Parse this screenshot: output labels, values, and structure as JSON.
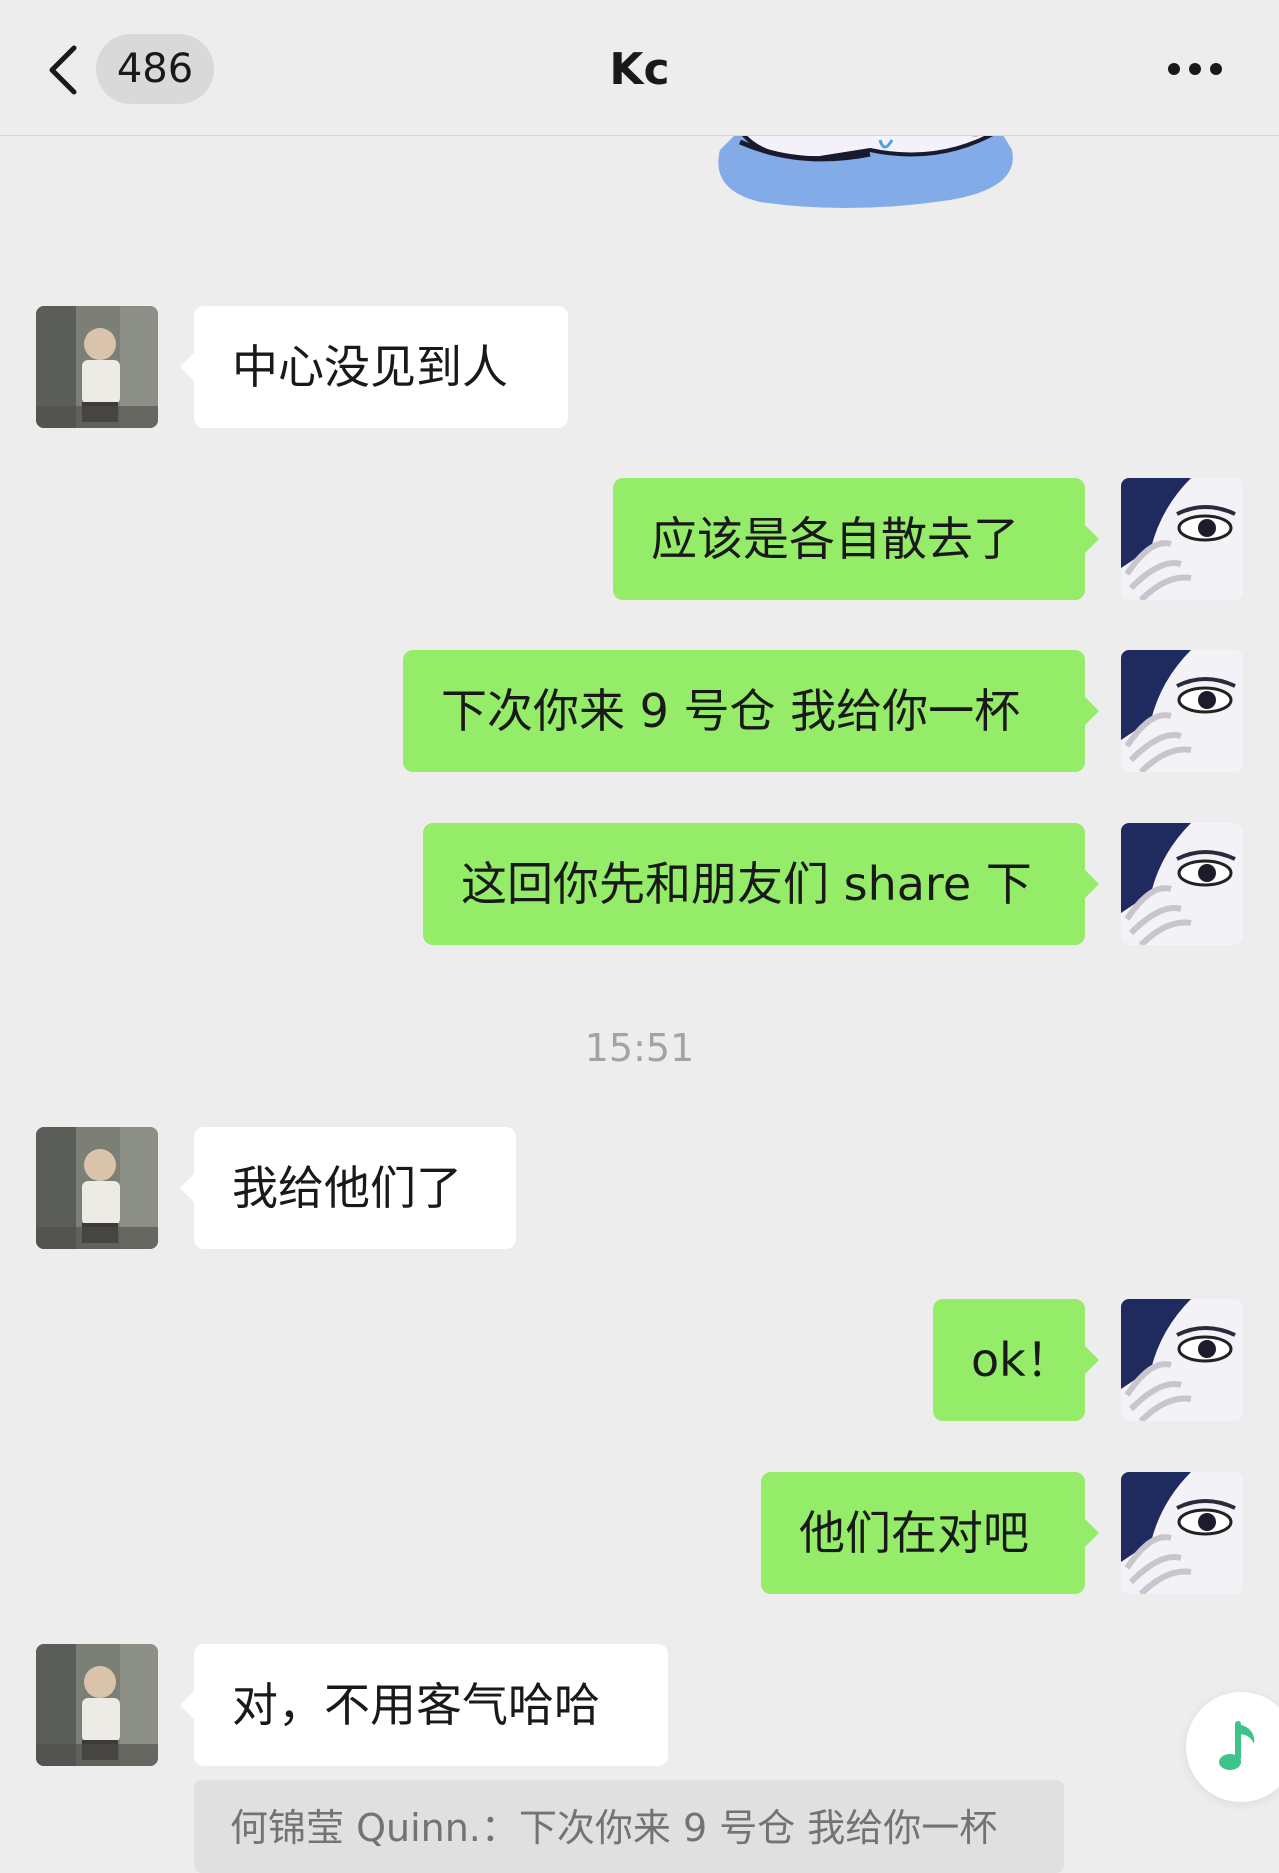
{
  "header": {
    "unread_count": "486",
    "title": "Kc"
  },
  "messages": [
    {
      "side": "left",
      "text": "中心没见到人"
    },
    {
      "side": "right",
      "text": "应该是各自散去了"
    },
    {
      "side": "right",
      "text": "下次你来 9 号仓  我给你一杯"
    },
    {
      "side": "right",
      "text": "这回你先和朋友们 share 下"
    },
    {
      "side": "left",
      "text": "我给他们了"
    },
    {
      "side": "right",
      "text": "ok！"
    },
    {
      "side": "right",
      "text": "他们在对吧"
    },
    {
      "side": "left",
      "text": "对，不用客气哈哈"
    }
  ],
  "timestamp": "15:51",
  "quote": {
    "text": "何锦莹 Quinn.：下次你来 9 号仓 我给你一杯"
  },
  "colors": {
    "background": "#ededed",
    "sent_bubble": "#95ec69",
    "received_bubble": "#ffffff",
    "timestamp_text": "#a3a3a3",
    "music_icon": "#3cc48b"
  },
  "icons": {
    "back": "chevron-left-icon",
    "more": "ellipsis-icon",
    "music": "music-note-icon"
  }
}
